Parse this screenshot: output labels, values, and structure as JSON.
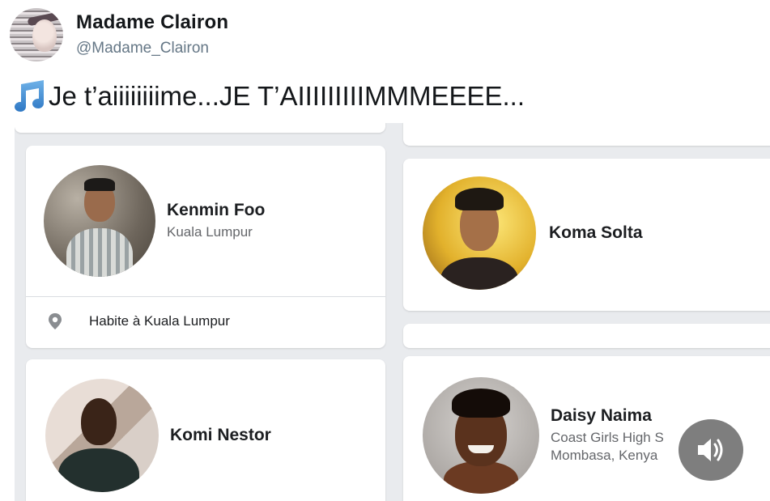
{
  "tweet": {
    "display_name": "Madame Clairon",
    "handle": "@Madame_Clairon",
    "text": "Je t’aiiiiiiiime...JE T’AIIIIIIIIIMMMEEEE...",
    "avatar_icon": "profile-photo",
    "emoji_icon": "music-notes-icon"
  },
  "profiles": [
    {
      "name": "Kenmin Foo",
      "subtitle": "Kuala Lumpur",
      "detail": "Habite à Kuala Lumpur",
      "detail_icon": "location-pin-icon"
    },
    {
      "name": "Koma Solta"
    },
    {
      "name": "Komi Nestor"
    },
    {
      "name": "Daisy Naima",
      "subtitle_line1": "Coast Girls High S",
      "subtitle_line2": "Mombasa, Kenya"
    }
  ],
  "overlay": {
    "icon": "speaker-icon",
    "accent": "#5a5a5a"
  },
  "colors": {
    "background": "#e9ebee",
    "card": "#ffffff",
    "secondary_text": "#65676b"
  }
}
